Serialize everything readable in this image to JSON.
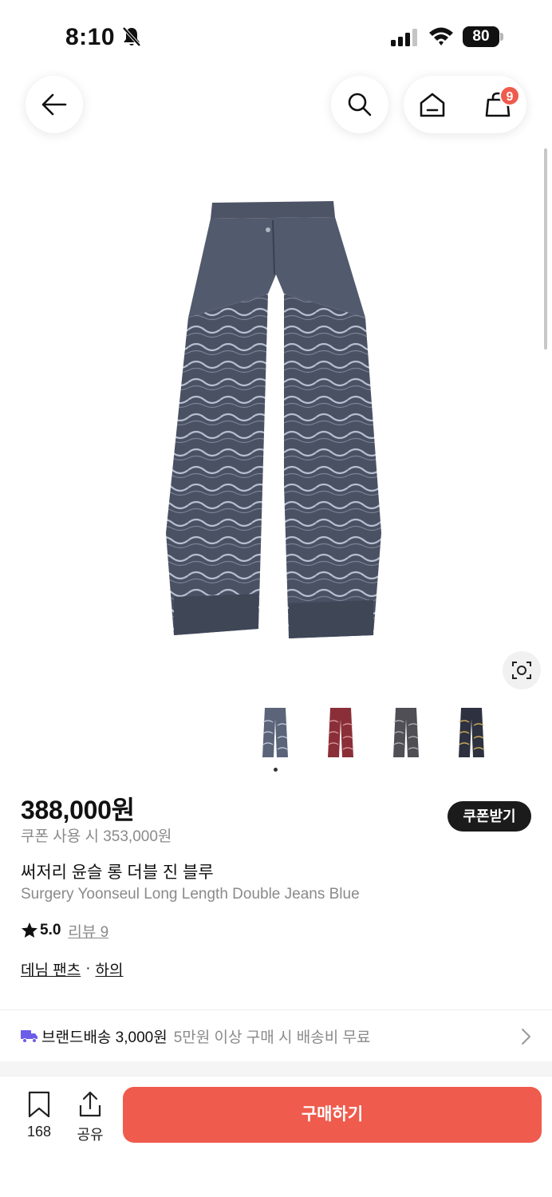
{
  "status_bar": {
    "time": "8:10",
    "battery": "80"
  },
  "nav": {
    "cart_count": "9"
  },
  "price": {
    "main": "388,000원",
    "coupon_price": "쿠폰 사용 시 353,000원",
    "coupon_button": "쿠폰받기"
  },
  "product": {
    "title_ko": "써저리 윤슬 롱 더블 진 블루",
    "title_en": "Surgery Yoonseul Long Length Double Jeans Blue",
    "rating": "5.0",
    "review_label": "리뷰 9",
    "categories": [
      "데님 팬츠",
      "하의"
    ],
    "category_separator": "·"
  },
  "thumbnails": [
    {
      "color": "#5b6479",
      "name": "blue"
    },
    {
      "color": "#8a2f37",
      "name": "red"
    },
    {
      "color": "#4f4f55",
      "name": "grey"
    },
    {
      "color": "#2d3140",
      "name": "black-yellow"
    }
  ],
  "shipping": {
    "label": "브랜드배송 3,000원",
    "note": "5만원 이상 구매 시 배송비 무료"
  },
  "bottom_bar": {
    "bookmark_count": "168",
    "share_label": "공유",
    "buy_label": "구매하기"
  },
  "colors": {
    "accent": "#ef5b4d",
    "dark": "#1b1b1b",
    "truck": "#6b5de8"
  }
}
